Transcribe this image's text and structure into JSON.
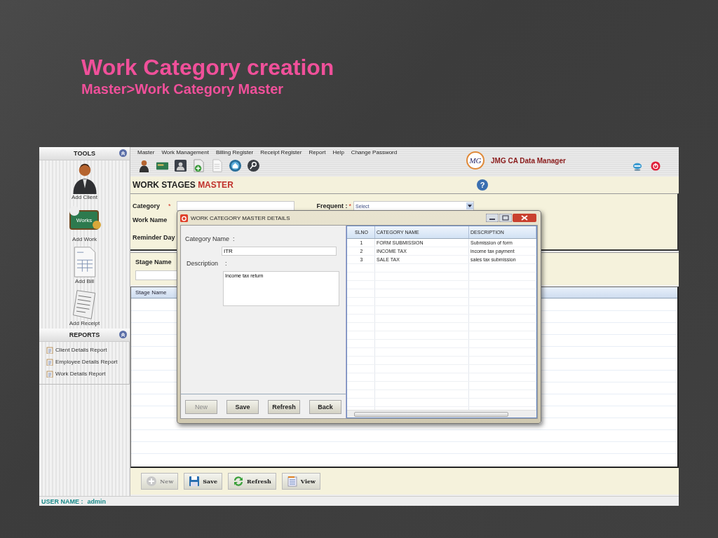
{
  "slide": {
    "title": "Work Category creation",
    "subtitle": "Master>Work Category Master"
  },
  "menu": [
    "Master",
    "Work Management",
    "Billing Register",
    "Receipt Register",
    "Report",
    "Help",
    "Change Password"
  ],
  "brand": {
    "logo": "MG",
    "name": "JMG CA Data Manager"
  },
  "sidebar": {
    "tools_title": "TOOLS",
    "tools": [
      {
        "label": "Add Client",
        "kind": "client"
      },
      {
        "label": "Add Work",
        "kind": "works",
        "badge": "Works"
      },
      {
        "label": "Add Bill",
        "kind": "bill"
      },
      {
        "label": "Add Receipt",
        "kind": "receipt"
      }
    ],
    "reports_title": "REPORTS",
    "reports": [
      "Client Details Report",
      "Employee Details Report",
      "Work Details Report"
    ]
  },
  "form": {
    "title": "WORK STAGES",
    "title_accent": "MASTER",
    "help": "?",
    "category_label": "Category",
    "required_mark": "*",
    "work_name_label": "Work Name",
    "reminder_label": "Reminder Day",
    "frequent_label": "Frequent :",
    "frequent_mark": "*",
    "frequent_value": "Select",
    "stage_label": "Stage Name",
    "grid_column": "Stage Name"
  },
  "buttons": [
    {
      "label": "New",
      "kind": "new",
      "disabled": true
    },
    {
      "label": "Save",
      "kind": "save",
      "disabled": false
    },
    {
      "label": "Refresh",
      "kind": "refresh",
      "disabled": false
    },
    {
      "label": "View",
      "kind": "view",
      "disabled": false
    }
  ],
  "status": {
    "label": "USER NAME :",
    "value": "admin"
  },
  "dialog": {
    "title": "WORK CATEGORY MASTER DETAILS",
    "name_label": "Category Name  :",
    "name_value": "ITR",
    "desc_label": "Description    :",
    "desc_value": "Income tax return",
    "buttons": [
      {
        "label": "New",
        "disabled": true
      },
      {
        "label": "Save",
        "disabled": false
      },
      {
        "label": "Refresh",
        "disabled": false
      },
      {
        "label": "Back",
        "disabled": false
      }
    ],
    "columns": [
      "SLNO",
      "CATEGORY NAME",
      "DESCRIPTION"
    ],
    "rows": [
      [
        "1",
        "FORM SUBMISSION",
        "Submission of form"
      ],
      [
        "2",
        "INCOME TAX",
        "income tax payment"
      ],
      [
        "3",
        "SALE TAX",
        "sales tax submission"
      ]
    ]
  }
}
